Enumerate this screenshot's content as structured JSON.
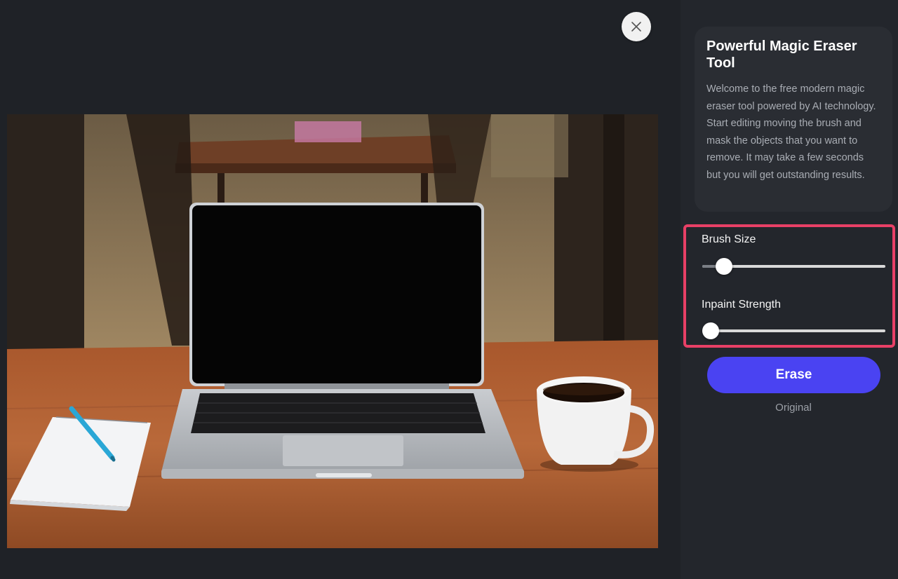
{
  "window": {
    "close_icon": "close-icon"
  },
  "canvas": {
    "image_description_icon": "photo"
  },
  "sidebar": {
    "intro": {
      "title": "Powerful Magic Eraser Tool",
      "text": "Welcome to the free modern magic eraser tool powered by AI technology. Start editing moving the brush and mask the objects that you want to remove. It may take a few seconds but you will get outstanding results."
    },
    "controls": {
      "highlight_color": "#e84066",
      "brush_size": {
        "label": "Brush Size",
        "value_fraction": 0.12
      },
      "inpaint_strength": {
        "label": "Inpaint Strength",
        "value_fraction": 0.0
      }
    },
    "erase_button": {
      "label": "Erase",
      "color": "#4a43f2"
    },
    "original_label": "Original"
  }
}
